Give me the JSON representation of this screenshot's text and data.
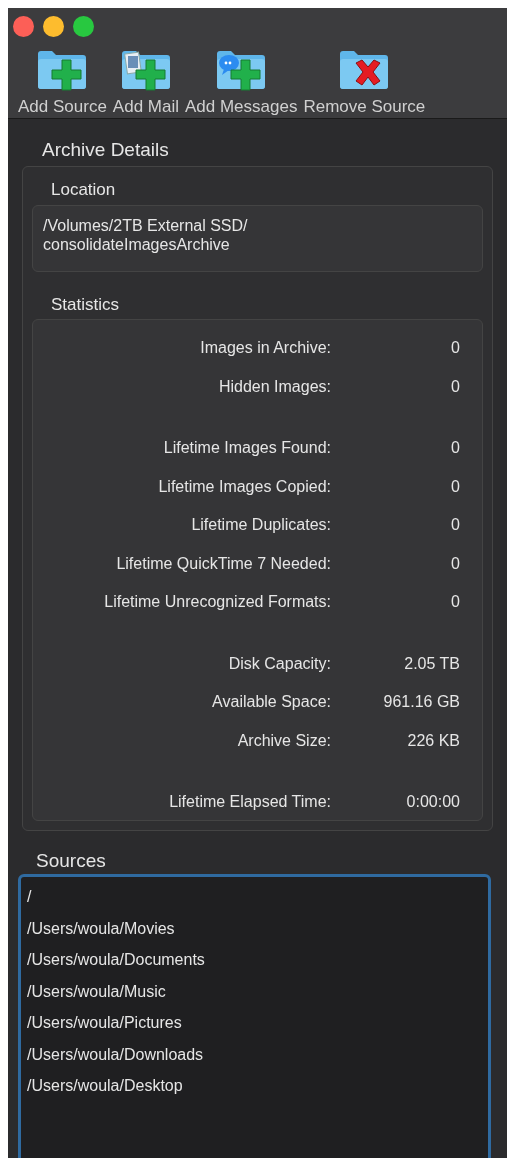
{
  "toolbar": [
    {
      "label": "Add Source",
      "kind": "add"
    },
    {
      "label": "Add Mail",
      "kind": "mail"
    },
    {
      "label": "Add Messages",
      "kind": "messages"
    },
    {
      "label": "Remove Source",
      "kind": "remove"
    }
  ],
  "archive_details": {
    "title": "Archive Details",
    "location": {
      "title": "Location",
      "path": "/Volumes/2TB External SSD/\nconsolidateImagesArchive"
    },
    "statistics": {
      "title": "Statistics",
      "groups": [
        [
          {
            "label": "Images in Archive:",
            "value": "0"
          },
          {
            "label": "Hidden Images:",
            "value": "0"
          }
        ],
        [
          {
            "label": "Lifetime Images Found:",
            "value": "0"
          },
          {
            "label": "Lifetime Images Copied:",
            "value": "0"
          },
          {
            "label": "Lifetime Duplicates:",
            "value": "0"
          },
          {
            "label": "Lifetime QuickTime 7 Needed:",
            "value": "0"
          },
          {
            "label": "Lifetime Unrecognized Formats:",
            "value": "0"
          }
        ],
        [
          {
            "label": "Disk Capacity:",
            "value": "2.05 TB"
          },
          {
            "label": "Available Space:",
            "value": "961.16 GB"
          },
          {
            "label": "Archive Size:",
            "value": "226 KB"
          }
        ],
        [
          {
            "label": "Lifetime Elapsed Time:",
            "value": "0:00:00"
          }
        ]
      ]
    }
  },
  "sources": {
    "title": "Sources",
    "items": [
      "/",
      "/Users/woula/Movies",
      "/Users/woula/Documents",
      "/Users/woula/Music",
      "/Users/woula/Pictures",
      "/Users/woula/Downloads",
      "/Users/woula/Desktop"
    ]
  }
}
